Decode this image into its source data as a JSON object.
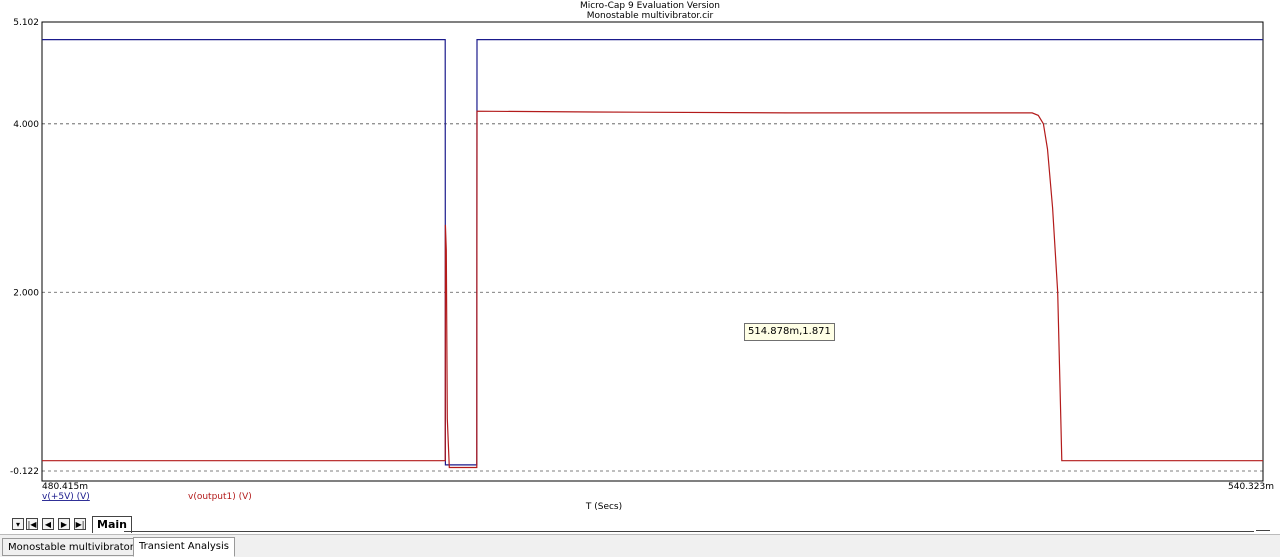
{
  "window": {
    "title": "Micro-Cap 9 Evaluation Version",
    "subtitle": "Monostable multivibrator.cir"
  },
  "chart_data": {
    "type": "line",
    "title": "Micro-Cap 9 Evaluation Version",
    "subtitle": "Monostable multivibrator.cir",
    "xlabel": "T (Secs)",
    "ylabel": "",
    "xlim": [
      0.480415,
      0.540323
    ],
    "ylim": [
      -0.122,
      5.102
    ],
    "x_tick_labels": [
      "480.415m",
      "540.323m"
    ],
    "y_ticks": [
      {
        "value": 5.102,
        "label": "5.102"
      },
      {
        "value": 4.0,
        "label": "4.000"
      },
      {
        "value": 2.0,
        "label": "2.000"
      },
      {
        "value": -0.122,
        "label": "-0.122"
      }
    ],
    "grid": true,
    "series": [
      {
        "name": "v(+5V) (V)",
        "color": "#1a1a8c",
        "x": [
          0.480415,
          0.5002,
          0.50021,
          0.50175,
          0.50176,
          0.540323
        ],
        "y": [
          5.0,
          5.0,
          -0.05,
          -0.05,
          5.0,
          5.0
        ]
      },
      {
        "name": "v(output1) (V)",
        "color": "#b31b1b",
        "x": [
          0.480415,
          0.5002,
          0.50021,
          0.50025,
          0.5003,
          0.5004,
          0.50175,
          0.50176,
          0.5075,
          0.517,
          0.529,
          0.5293,
          0.52955,
          0.52975,
          0.53,
          0.53025,
          0.5304,
          0.53045,
          0.540323
        ],
        "y": [
          0.0,
          0.0,
          2.8,
          2.5,
          0.5,
          -0.08,
          -0.08,
          4.15,
          4.14,
          4.13,
          4.13,
          4.1,
          4.0,
          3.7,
          3.0,
          2.0,
          0.5,
          0.0,
          0.0
        ]
      }
    ]
  },
  "tooltip": {
    "text": "514.878m,1.871"
  },
  "tabs": {
    "main_label": "Main",
    "nav_glyphs": [
      "▾",
      "|◀",
      "◀",
      "▶",
      "▶|"
    ]
  },
  "bottom_tabs": [
    "Monostable multivibrator.cir",
    "Transient Analysis"
  ]
}
